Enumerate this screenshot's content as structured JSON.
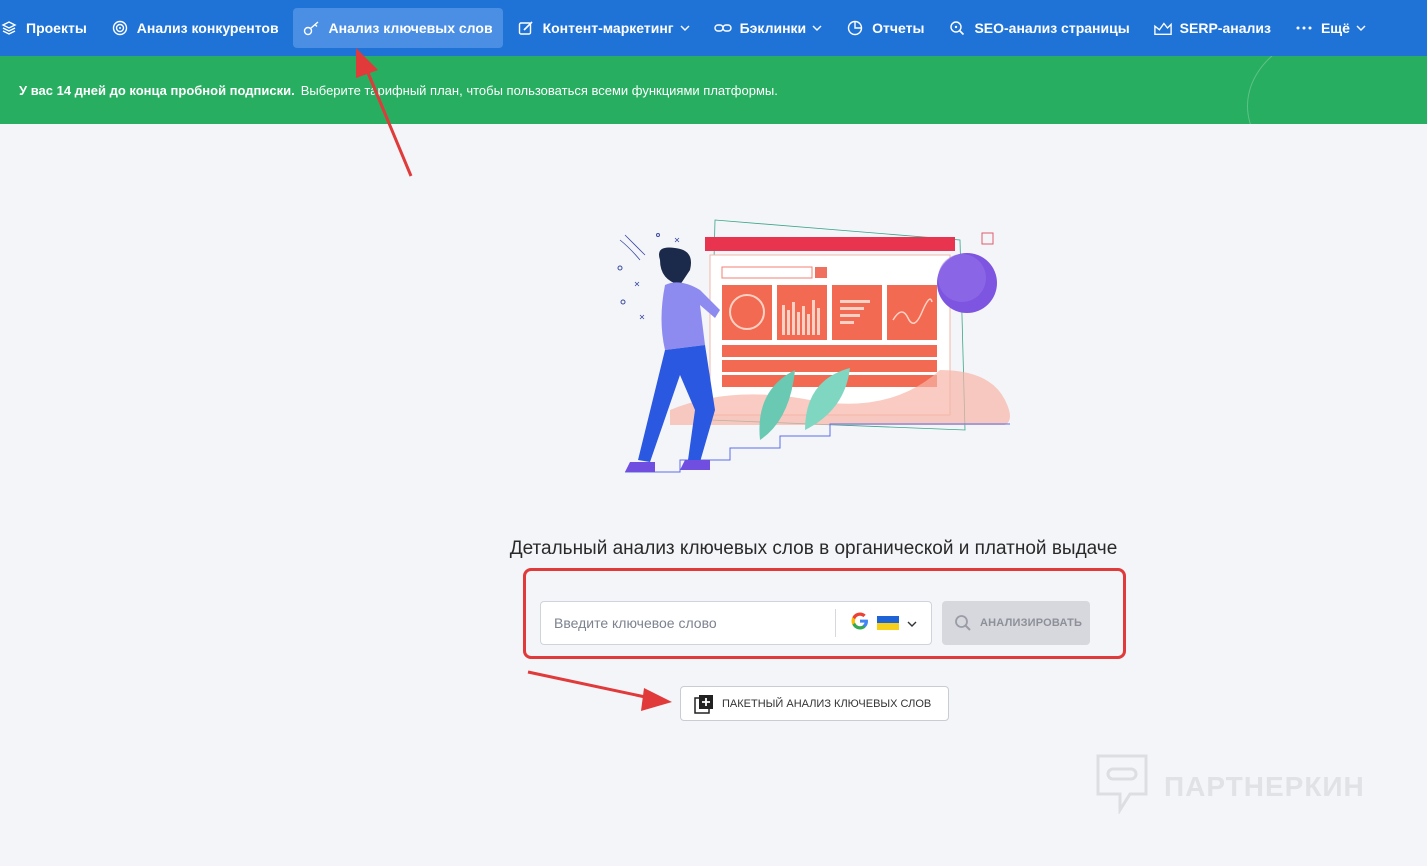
{
  "nav": {
    "items": [
      {
        "label": "Проекты",
        "icon": "layers-icon"
      },
      {
        "label": "Анализ конкурентов",
        "icon": "target-icon"
      },
      {
        "label": "Анализ ключевых слов",
        "icon": "key-icon",
        "active": true
      },
      {
        "label": "Контент-маркетинг",
        "icon": "edit-icon",
        "dropdown": true
      },
      {
        "label": "Бэклинки",
        "icon": "link-icon",
        "dropdown": true
      },
      {
        "label": "Отчеты",
        "icon": "pie-chart-icon"
      },
      {
        "label": "SEO-анализ страницы",
        "icon": "search-icon"
      },
      {
        "label": "SERP-анализ",
        "icon": "serp-chart-icon"
      },
      {
        "label": "Ещё",
        "icon": "more-dots-icon",
        "dropdown": true
      }
    ]
  },
  "banner": {
    "bold": "У вас 14 дней до конца пробной подписки.",
    "text": "Выберите тарифный план, чтобы пользоваться всеми функциями платформы."
  },
  "main": {
    "headline": "Детальный анализ ключевых слов в органической и платной выдаче",
    "search": {
      "placeholder": "Введите ключевое слово",
      "value": ""
    },
    "analyze_label": "АНАЛИЗИРОВАТЬ",
    "batch_label": "ПАКЕТНЫЙ АНАЛИЗ КЛЮЧЕВЫХ СЛОВ"
  },
  "watermark": {
    "text": "ПАРТНЕРКИН"
  },
  "colors": {
    "nav_bg": "#1f73d6",
    "banner_bg": "#27ae60",
    "annotation_red": "#e03a3a"
  }
}
